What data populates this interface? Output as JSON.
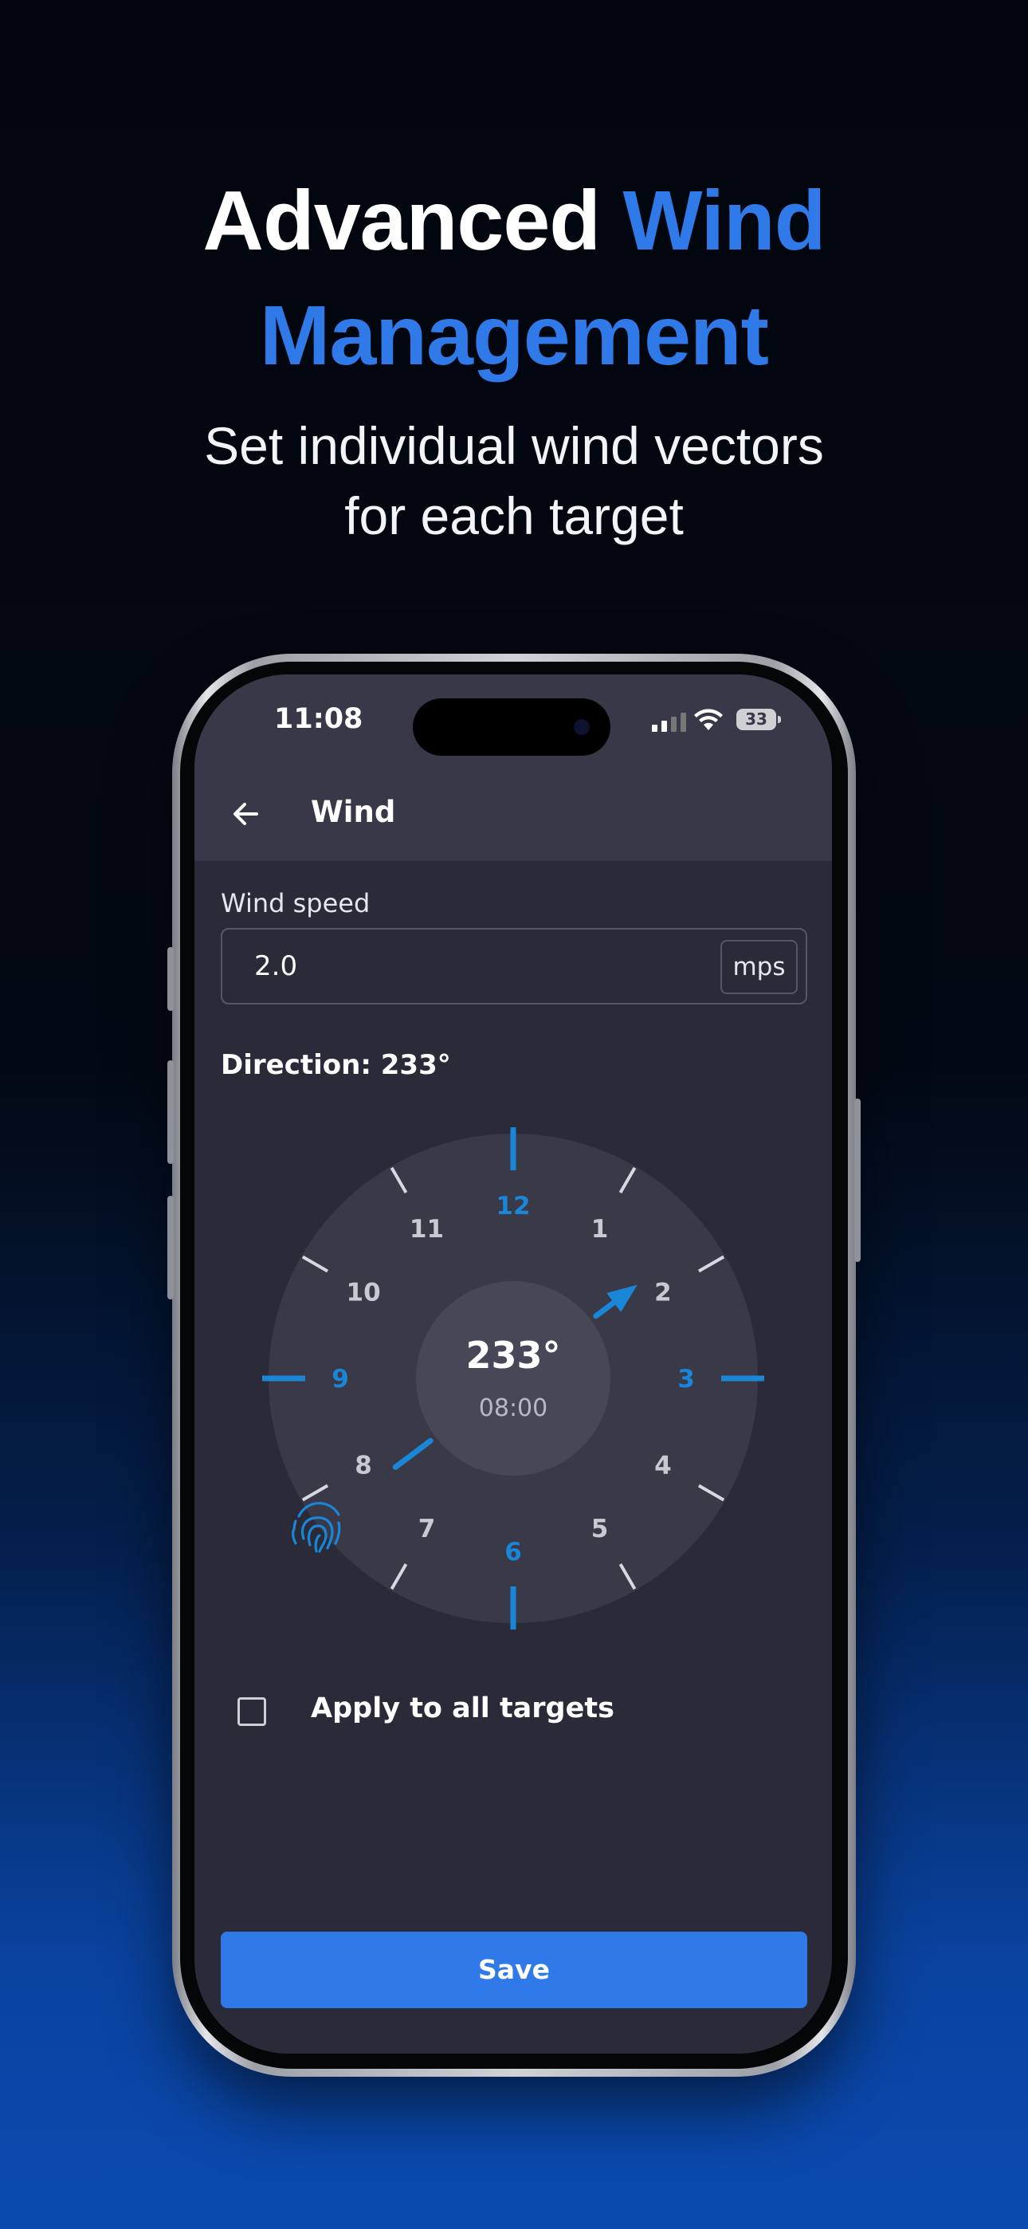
{
  "hero": {
    "title_part1": "Advanced",
    "title_part2": "Wind",
    "title_part3": "Management",
    "subtitle_line1": "Set individual wind vectors",
    "subtitle_line2": "for each target"
  },
  "colors": {
    "accent": "#2f7ae8",
    "dial_accent": "#1a86d8",
    "screen_bg": "#2a2a39",
    "appbar_bg": "#393849"
  },
  "status_bar": {
    "time": "11:08",
    "battery": "33"
  },
  "app_bar": {
    "back_icon": "arrow-left-icon",
    "title": "Wind"
  },
  "wind_speed": {
    "label": "Wind speed",
    "value": "2.0",
    "unit": "mps"
  },
  "direction": {
    "label": "Direction: 233°"
  },
  "dial": {
    "hour_labels": [
      "12",
      "1",
      "2",
      "3",
      "4",
      "5",
      "6",
      "7",
      "8",
      "9",
      "10",
      "11"
    ],
    "accent_hours": [
      "12",
      "3",
      "6",
      "9"
    ],
    "center_value": "233°",
    "center_time": "08:00",
    "direction_degrees": 233,
    "touch_icon": "fingerprint-icon"
  },
  "apply_all": {
    "label": "Apply to all targets",
    "checked": false
  },
  "save_button": {
    "label": "Save"
  }
}
